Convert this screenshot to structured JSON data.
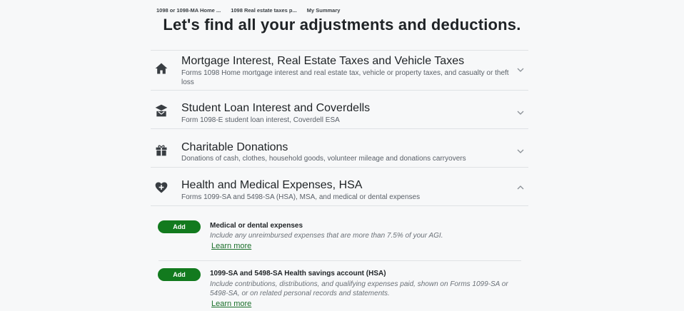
{
  "breadcrumb": [
    "1098 or 1098-MA Home ...",
    "1098 Real estate taxes p...",
    "My Summary"
  ],
  "page_title": "Let's find all your adjustments and deductions.",
  "sections": [
    {
      "heading": "Mortgage Interest, Real Estate Taxes and Vehicle Taxes",
      "description": "Forms 1098 Home mortgage interest and real estate tax, vehicle or property taxes, and casualty or theft loss",
      "icon": "home-icon",
      "expanded": false
    },
    {
      "heading": "Student Loan Interest and Coverdells",
      "description": "Form 1098-E student loan interest, Coverdell ESA",
      "icon": "graduation-cap-icon",
      "expanded": false
    },
    {
      "heading": "Charitable Donations",
      "description": "Donations of cash, clothes, household goods, volunteer mileage and donations carryovers",
      "icon": "gift-icon",
      "expanded": false
    },
    {
      "heading": "Health and Medical Expenses, HSA",
      "description": "Forms 1099-SA and 5498-SA (HSA), MSA, and medical or dental expenses",
      "icon": "heart-plus-icon",
      "expanded": true
    }
  ],
  "items": [
    {
      "button": "Add",
      "title": "Medical or dental expenses",
      "description": "Include any unreimbursed expenses that are more than 7.5% of your AGI.",
      "link": "Learn more"
    },
    {
      "button": "Add",
      "title": "1099-SA and 5498-SA Health savings account (HSA)",
      "description": "Include contributions, distributions, and qualifying expenses paid, shown on Forms 1099-SA or 5498-SA, or on related personal records and statements.",
      "link": "Learn more"
    }
  ],
  "colors": {
    "accent": "#127a1e",
    "background": "#f7f8f9",
    "link": "#1a6f2a"
  }
}
